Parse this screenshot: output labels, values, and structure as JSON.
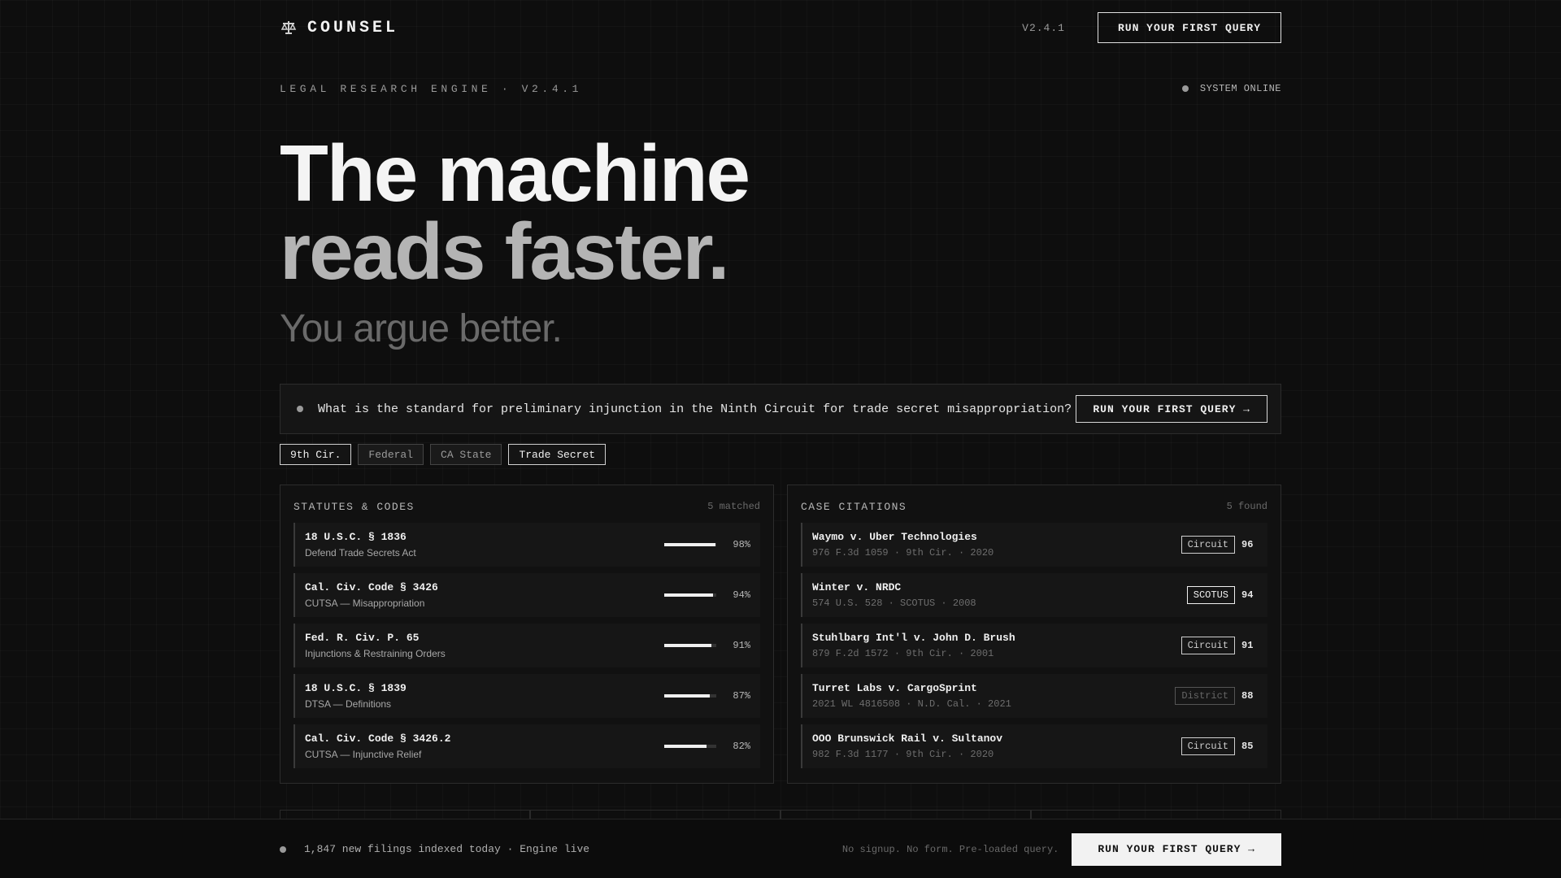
{
  "brand": {
    "name": "COUNSEL",
    "icon": "scales-icon"
  },
  "header": {
    "version": "V2.4.1",
    "cta": "RUN YOUR FIRST QUERY"
  },
  "eyebrow": {
    "text": "LEGAL RESEARCH ENGINE · V2.4.1",
    "status": "SYSTEM ONLINE"
  },
  "hero": {
    "line1": "The machine",
    "line2": "reads faster.",
    "sub": "You argue better."
  },
  "query": {
    "text": "What is the standard for preliminary injunction in the Ninth Circuit for trade secret misappropriation?",
    "button": "RUN YOUR FIRST QUERY →"
  },
  "filters": [
    {
      "label": "9th Cir.",
      "active": true
    },
    {
      "label": "Federal",
      "active": false
    },
    {
      "label": "CA State",
      "active": false
    },
    {
      "label": "Trade Secret",
      "active": true
    }
  ],
  "statutes": {
    "title": "STATUTES & CODES",
    "count": "5 matched",
    "items": [
      {
        "code": "18 U.S.C. § 1836",
        "desc": "Defend Trade Secrets Act",
        "pct": "98%",
        "value": 0.98
      },
      {
        "code": "Cal. Civ. Code § 3426",
        "desc": "CUTSA — Misappropriation",
        "pct": "94%",
        "value": 0.94
      },
      {
        "code": "Fed. R. Civ. P. 65",
        "desc": "Injunctions & Restraining Orders",
        "pct": "91%",
        "value": 0.91
      },
      {
        "code": "18 U.S.C. § 1839",
        "desc": "DTSA — Definitions",
        "pct": "87%",
        "value": 0.87
      },
      {
        "code": "Cal. Civ. Code § 3426.2",
        "desc": "CUTSA — Injunctive Relief",
        "pct": "82%",
        "value": 0.82
      }
    ]
  },
  "cases": {
    "title": "CASE CITATIONS",
    "count": "5 found",
    "items": [
      {
        "name": "Waymo v. Uber Technologies",
        "cite": "976 F.3d 1059 · 9th Cir. · 2020",
        "court": "Circuit",
        "score": "96"
      },
      {
        "name": "Winter v. NRDC",
        "cite": "574 U.S. 528 · SCOTUS · 2008",
        "court": "SCOTUS",
        "score": "94"
      },
      {
        "name": "Stuhlbarg Int'l v. John D. Brush",
        "cite": "879 F.2d 1572 · 9th Cir. · 2001",
        "court": "Circuit",
        "score": "91"
      },
      {
        "name": "Turret Labs v. CargoSprint",
        "cite": "2021 WL 4816508 · N.D. Cal. · 2021",
        "court": "District",
        "score": "88"
      },
      {
        "name": "OOO Brunswick Rail v. Sultanov",
        "cite": "982 F.3d 1177 · 9th Cir. · 2020",
        "court": "Circuit",
        "score": "85"
      }
    ]
  },
  "footer": {
    "status": "1,847 new filings indexed today · Engine live",
    "note": "No signup. No form. Pre-loaded query.",
    "cta": "RUN YOUR FIRST QUERY →"
  },
  "colors": {
    "background": "#0e0e0e",
    "accent": "#f2f2f2",
    "muted": "#6a6a6a"
  }
}
